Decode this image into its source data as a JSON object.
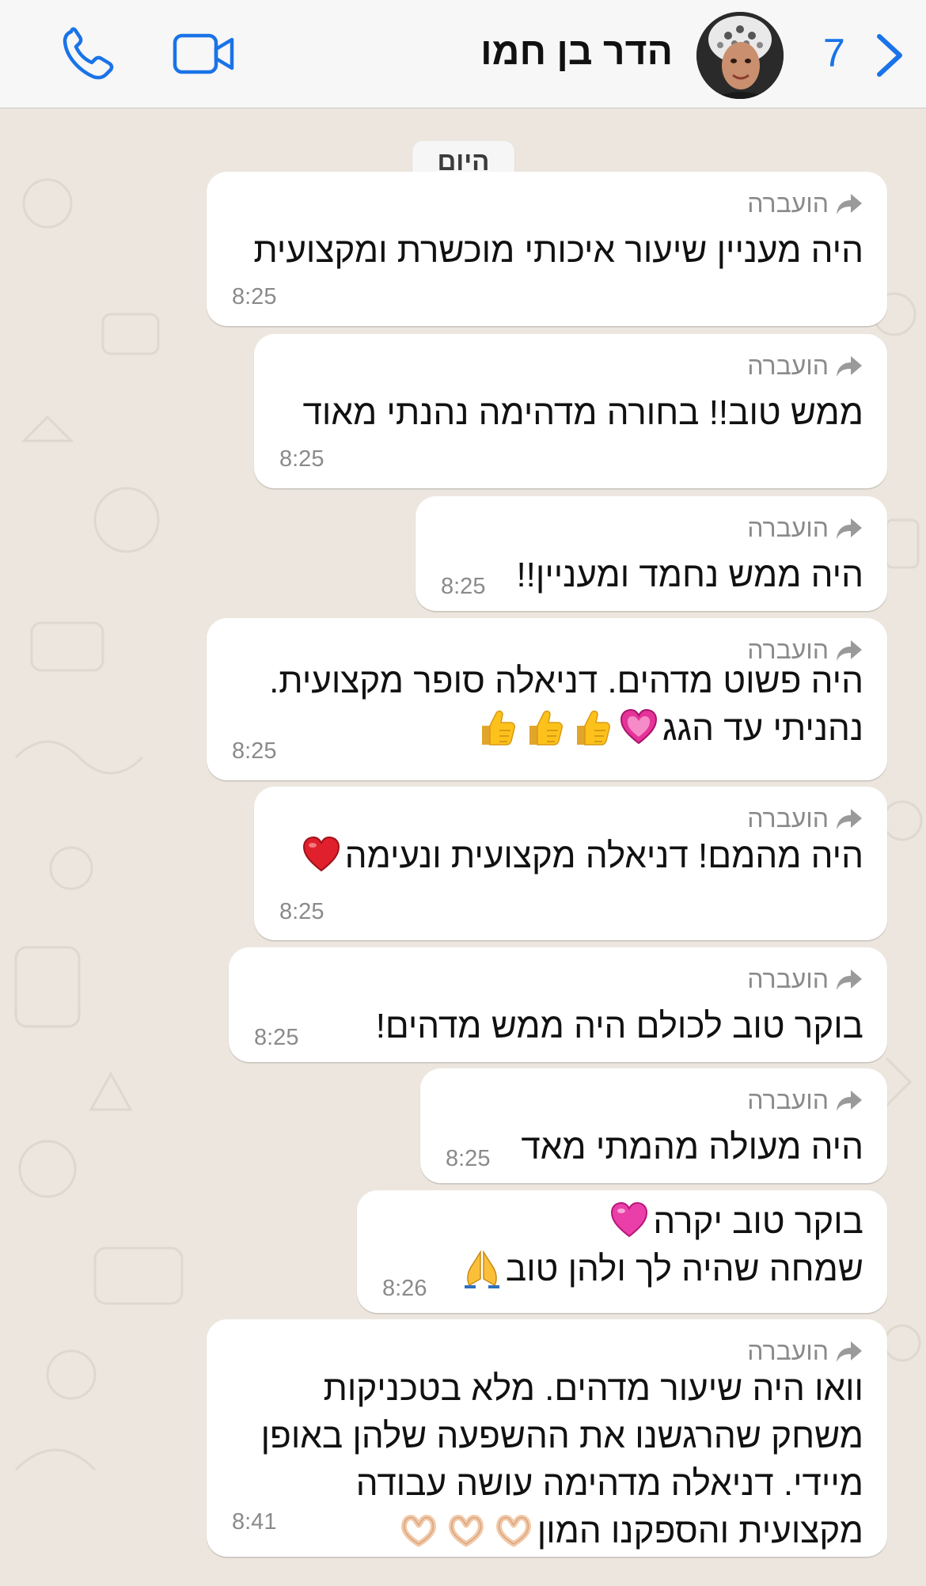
{
  "header": {
    "contact_name": "הדר בן חמו",
    "unread_count": "7",
    "icons": [
      "phone-icon",
      "video-icon",
      "avatar",
      "chevron-back-icon"
    ],
    "accent_color": "#1a73e8"
  },
  "chat": {
    "date_label": "היום",
    "forwarded_label": "הועברה",
    "messages": [
      {
        "forwarded": true,
        "lines": [
          "היה מעניין שיעור איכותי מוכשרת ומקצועית"
        ],
        "time": "8:25"
      },
      {
        "forwarded": true,
        "lines": [
          "ממש טוב!! בחורה מדהימה נהנתי מאוד"
        ],
        "time": "8:25"
      },
      {
        "forwarded": true,
        "lines": [
          "היה ממש נחמד ומעניין!!"
        ],
        "time": "8:25"
      },
      {
        "forwarded": true,
        "lines": [
          "היה פשוט מדהים. דניאלה סופר מקצועית.",
          "נהניתי עד הגג"
        ],
        "emojis": [
          "sparkling-heart-emoji",
          "thumbs-up-emoji",
          "thumbs-up-emoji",
          "thumbs-up-emoji"
        ],
        "time": "8:25"
      },
      {
        "forwarded": true,
        "lines": [
          "היה מהמם! דניאלה מקצועית ונעימה"
        ],
        "emojis": [
          "red-heart-emoji"
        ],
        "time": "8:25"
      },
      {
        "forwarded": true,
        "lines": [
          "בוקר טוב לכולם היה ממש מדהים!"
        ],
        "time": "8:25"
      },
      {
        "forwarded": true,
        "lines": [
          "היה מעולה מהמתי מאד"
        ],
        "time": "8:25"
      },
      {
        "forwarded": false,
        "lines": [
          "בוקר טוב יקרה",
          "שמחה שהיה לך ולהן טוב"
        ],
        "emojis": [
          "pink-heart-emoji",
          "folded-hands-emoji"
        ],
        "time": "8:26"
      },
      {
        "forwarded": true,
        "lines": [
          "וואו היה שיעור מדהים. מלא בטכניקות",
          "משחק שהרגשנו את ההשפעה שלהן באופן",
          "מיידי. דניאלה מדהימה עושה עבודה",
          "מקצועית והספקנו המון"
        ],
        "emojis": [
          "heart-hands-emoji",
          "heart-hands-emoji",
          "heart-hands-emoji"
        ],
        "time": "8:41"
      }
    ]
  }
}
